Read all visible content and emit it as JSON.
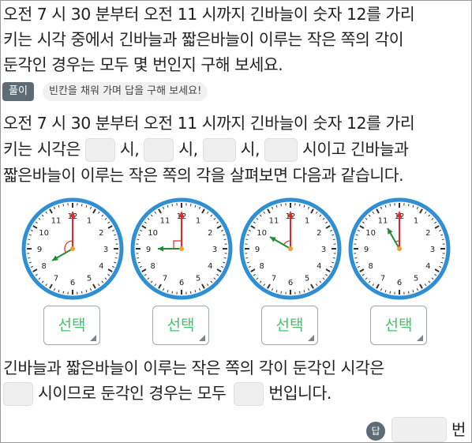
{
  "problem": {
    "line1": "오전 7 시 30 분부터 오전 11 시까지 긴바늘이 숫자 12를 가리",
    "line2": "키는 시각 중에서 긴바늘과 짧은바늘이 이루는 작은 쪽의 각이",
    "line3": "둔각인 경우는 모두 몇 번인지 구해 보세요."
  },
  "solution_tag": "풀이",
  "hint": "빈칸을 채워 가며 답을 구해 보세요!",
  "solution": {
    "line1": "오전 7 시 30 분부터 오전 11 시까지 긴바늘이 숫자 12를 가리",
    "line2_prefix": "키는 시각은",
    "sep1": "시,",
    "sep2": "시,",
    "sep3": "시,",
    "line2_suffix": "시이고 긴바늘과",
    "line3": "짧은바늘이 이루는 작은 쪽의 각을 살펴보면 다음과 같습니다."
  },
  "clock_numbers": [
    "12",
    "1",
    "2",
    "3",
    "4",
    "5",
    "6",
    "7",
    "8",
    "9",
    "10",
    "11"
  ],
  "clocks": [
    {
      "hour": 8,
      "select_label": "선택"
    },
    {
      "hour": 9,
      "select_label": "선택"
    },
    {
      "hour": 10,
      "select_label": "선택"
    },
    {
      "hour": 11,
      "select_label": "선택"
    }
  ],
  "conclusion": {
    "line1": "긴바늘과 짧은바늘이 이루는 작은 쪽의 각이 둔각인 시각은",
    "line2_mid": "시이므로 둔각인 경우는 모두",
    "line2_end": "번입니다."
  },
  "answer": {
    "tag": "답",
    "unit": "번"
  },
  "colors": {
    "clock_rim": "#2f8fd4",
    "hand": "#e02a2a",
    "hour_hand": "#1f8a3a",
    "select_text": "#41c46a",
    "tag_bg": "#5d6b74"
  }
}
